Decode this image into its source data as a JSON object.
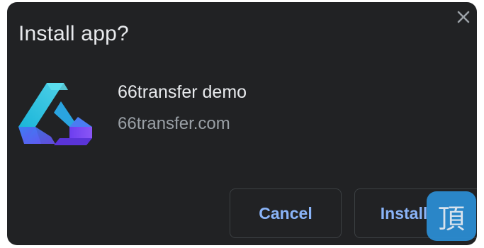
{
  "dialog": {
    "title": "Install app?",
    "close_icon": "close-icon"
  },
  "app": {
    "icon": "app-logo-icon",
    "name": "66transfer demo",
    "domain": "66transfer.com"
  },
  "actions": {
    "cancel_label": "Cancel",
    "install_label": "Install"
  },
  "watermark": {
    "glyph": "頂"
  },
  "colors": {
    "dialog_bg": "#212224",
    "title_text": "#e8eaed",
    "secondary_text": "#9aa0a6",
    "accent": "#8ab4f8",
    "button_border": "#3c4043"
  }
}
